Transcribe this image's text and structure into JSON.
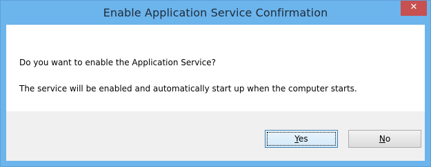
{
  "window": {
    "title": "Enable Application Service Confirmation",
    "close_glyph": "✕",
    "close_icon": "close-icon"
  },
  "message": {
    "question": "Do you want to enable the Application Service?",
    "detail": "The service will be enabled and automatically start up when the computer starts."
  },
  "buttons": {
    "yes": {
      "mnemonic": "Y",
      "rest": "es",
      "label": "Yes",
      "focused": true
    },
    "no": {
      "mnemonic": "N",
      "rest": "o",
      "label": "No",
      "focused": false
    }
  },
  "colors": {
    "titlebar": "#6cb4ec",
    "close_button": "#c75050",
    "button_bar": "#f0f0f0"
  }
}
